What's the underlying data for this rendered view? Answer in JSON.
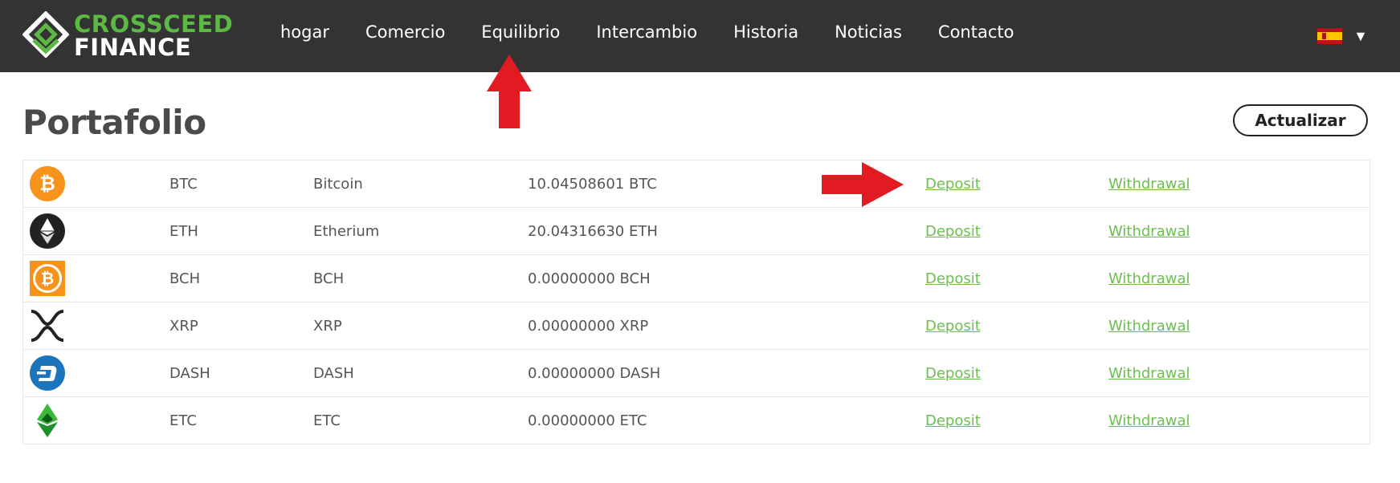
{
  "brand": {
    "line1": "CROSSCEED",
    "line2": "FINANCE",
    "green": "#5cb943"
  },
  "nav": [
    {
      "label": "hogar"
    },
    {
      "label": "Comercio"
    },
    {
      "label": "Equilibrio"
    },
    {
      "label": "Intercambio"
    },
    {
      "label": "Historia"
    },
    {
      "label": "Noticias"
    },
    {
      "label": "Contacto"
    }
  ],
  "lang": {
    "flag": "spain-flag-icon",
    "caret": "▼"
  },
  "page": {
    "title": "Portafolio",
    "refresh_label": "Actualizar"
  },
  "colors": {
    "header_bg": "#333333",
    "link": "#6bbf4e",
    "arrow": "#e21b23"
  },
  "portfolio": [
    {
      "icon": "bitcoin-icon",
      "symbol": "BTC",
      "name": "Bitcoin",
      "balance": "10.04508601 BTC",
      "deposit": "Deposit",
      "withdrawal": "Withdrawal"
    },
    {
      "icon": "ethereum-icon",
      "symbol": "ETH",
      "name": "Etherium",
      "balance": "20.04316630 ETH",
      "deposit": "Deposit",
      "withdrawal": "Withdrawal"
    },
    {
      "icon": "bitcoin-cash-icon",
      "symbol": "BCH",
      "name": "BCH",
      "balance": "0.00000000 BCH",
      "deposit": "Deposit",
      "withdrawal": "Withdrawal"
    },
    {
      "icon": "xrp-icon",
      "symbol": "XRP",
      "name": "XRP",
      "balance": "0.00000000 XRP",
      "deposit": "Deposit",
      "withdrawal": "Withdrawal"
    },
    {
      "icon": "dash-icon",
      "symbol": "DASH",
      "name": "DASH",
      "balance": "0.00000000 DASH",
      "deposit": "Deposit",
      "withdrawal": "Withdrawal"
    },
    {
      "icon": "ethereum-classic-icon",
      "symbol": "ETC",
      "name": "ETC",
      "balance": "0.00000000 ETC",
      "deposit": "Deposit",
      "withdrawal": "Withdrawal"
    }
  ]
}
